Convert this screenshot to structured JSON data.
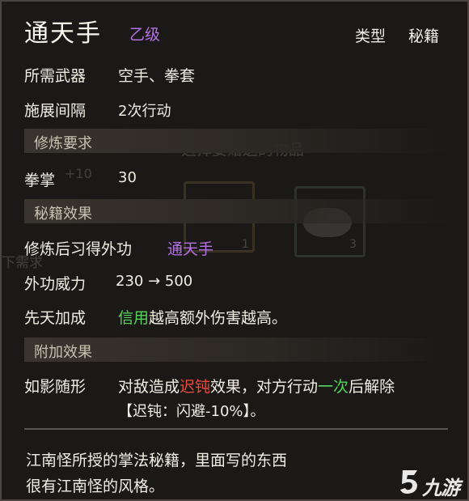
{
  "item": {
    "name": "通天手",
    "grade": "乙级",
    "type_label": "类型",
    "type_value": "秘籍"
  },
  "requirements": {
    "weapon_label": "所需武器",
    "weapon_value": "空手、拳套",
    "interval_label": "施展间隔",
    "interval_value": "2次行动"
  },
  "training": {
    "section_title": "修炼要求",
    "stat_label": "拳掌",
    "stat_value": "30"
  },
  "effect": {
    "section_title": "秘籍效果",
    "learn_label": "修炼后习得外功",
    "learn_value": "通天手",
    "power_label": "外功威力",
    "power_value": "230 → 500",
    "innate_label": "先天加成",
    "innate_highlight": "信用",
    "innate_text": "越高额外伤害越高。"
  },
  "bonus": {
    "section_title": "附加效果",
    "name": "如影随形",
    "text_part1": "对敌造成",
    "status_word": "迟钝",
    "text_part2": "效果，对方行动",
    "once_word": "一次",
    "text_part3": "后解除",
    "detail": "【迟钝：闪避-10%】。"
  },
  "description": {
    "line1": "江南怪所授的掌法秘籍，里面写的东西",
    "line2": "很有江南怪的风格。"
  },
  "background": {
    "dialog_title": "选择要赠送的物品",
    "side_text1": "+10",
    "side_text2": "下需求",
    "slot1_count": "1",
    "slot2_count": "3"
  },
  "watermark": {
    "text": "九游"
  },
  "colors": {
    "grade_purple": "#b571e4",
    "highlight_green": "#58d45a",
    "status_red": "#e64b3c",
    "panel_bg": "#1b1917"
  }
}
